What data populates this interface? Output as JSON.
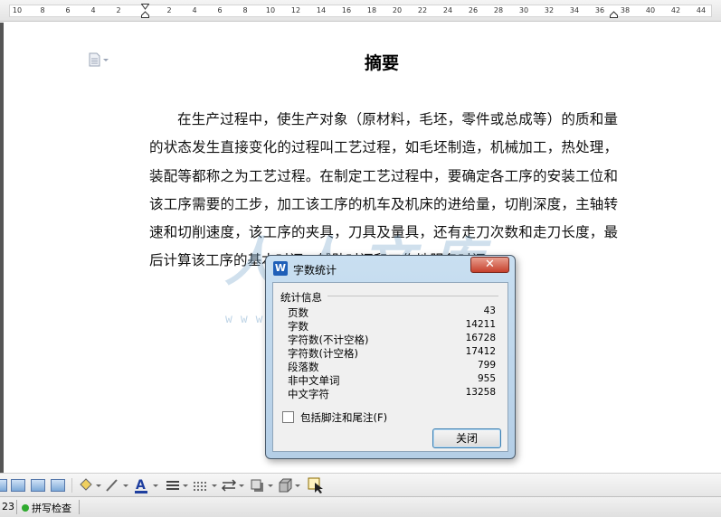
{
  "ruler": {
    "left_numbers": [
      "10",
      "8",
      "6",
      "4",
      "2"
    ],
    "right_numbers": [
      "2",
      "4",
      "6",
      "8",
      "10",
      "12",
      "14",
      "16",
      "18",
      "20",
      "22",
      "24",
      "26",
      "28",
      "30",
      "32",
      "34",
      "36",
      "38",
      "40",
      "42",
      "44"
    ]
  },
  "document": {
    "title": "摘要",
    "paragraph": "在生产过程中，使生产对象（原材料，毛坯，零件或总成等）的质和量的状态发生直接变化的过程叫工艺过程，如毛坯制造，机械加工，热处理，装配等都称之为工艺过程。在制定工艺过程中，要确定各工序的安装工位和该工序需要的工步，加工该工序的机车及机床的进给量，切削深度，主轴转速和切削速度，该工序的夹具，刀具及量具，还有走刀次数和走刀长度，最后计算该工序的基本时间，辅助时间和工作地服务时间。"
  },
  "watermark": {
    "logo": "人人文库",
    "url": "www.renrendoc.com"
  },
  "dialog": {
    "app_icon": "W",
    "title": "字数统计",
    "close_glyph": "✕",
    "group_label": "统计信息",
    "stats": [
      {
        "label": "页数",
        "value": "43"
      },
      {
        "label": "字数",
        "value": "14211"
      },
      {
        "label": "字符数(不计空格)",
        "value": "16728"
      },
      {
        "label": "字符数(计空格)",
        "value": "17412"
      },
      {
        "label": "段落数",
        "value": "799"
      },
      {
        "label": "非中文单词",
        "value": "955"
      },
      {
        "label": "中文字符",
        "value": "13258"
      }
    ],
    "checkbox_label": "包括脚注和尾注(F)",
    "checkbox_checked": false,
    "ok_label": "关闭"
  },
  "statusbar": {
    "page_fragment": "23",
    "spell_check": "拼写检查"
  },
  "colors": {
    "dialog_frame": "#b4cee6",
    "close_button": "#c6402c",
    "spell_ok": "#2eaa2e"
  }
}
